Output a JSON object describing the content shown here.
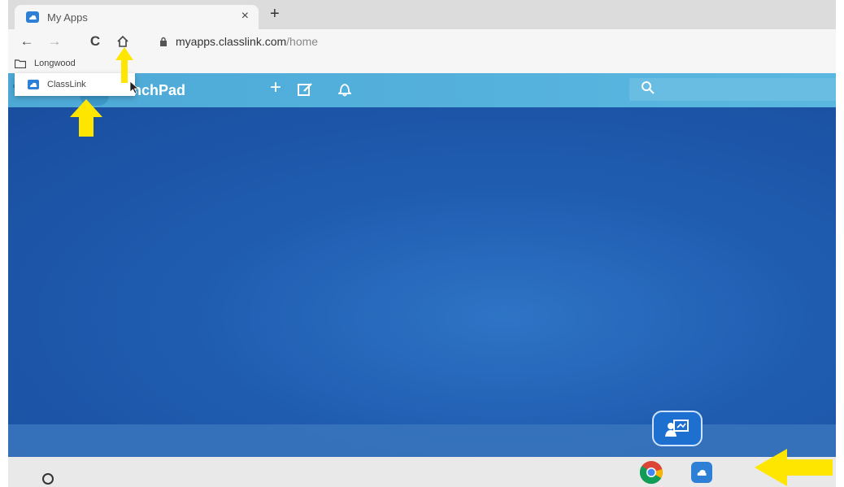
{
  "browser": {
    "tab": {
      "title": "My Apps",
      "close_glyph": "×",
      "favicon": "classlink-cloud-icon"
    },
    "new_tab_glyph": "+",
    "toolbar": {
      "back_glyph": "←",
      "forward_glyph": "→",
      "reload_glyph": "C",
      "url_host": "myapps.classlink.com",
      "url_path": "/home"
    },
    "bookmarks": [
      {
        "label": "Longwood",
        "icon": "folder-icon"
      }
    ],
    "bookmark_menu": [
      {
        "label": "ClassLink",
        "icon": "classlink-cloud-icon"
      }
    ]
  },
  "launchpad": {
    "title": "LaunchPad",
    "title_visible_part": "unchPad",
    "add_glyph": "+",
    "search_placeholder": ""
  },
  "annotations": {
    "arrow_color": "#ffe600",
    "arrows": [
      "home-button-arrow",
      "classlink-bookmark-arrow",
      "classlink-tray-arrow"
    ]
  },
  "colors": {
    "header": "#4da8d6",
    "body": "#1f5cb0",
    "taskbar": "#e9e9e9"
  }
}
